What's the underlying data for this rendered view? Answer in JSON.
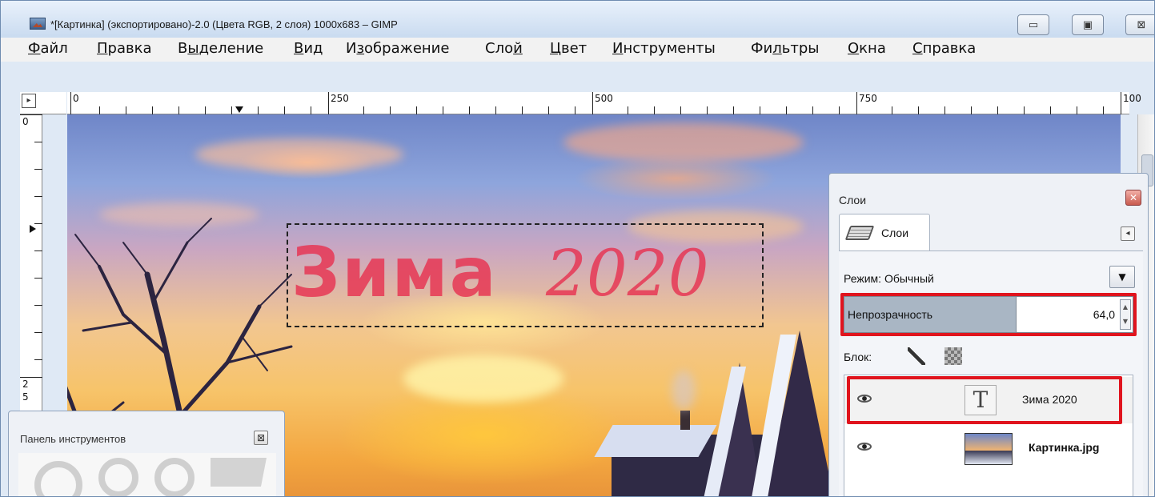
{
  "window": {
    "title": "*[Картинка] (экспортировано)-2.0 (Цвета RGB, 2 слоя) 1000x683 – GIMP",
    "minimize_glyph": "▭",
    "maximize_glyph": "▣",
    "close_glyph": "⊠"
  },
  "menu": [
    {
      "pre": "",
      "u": "Ф",
      "post": "айл"
    },
    {
      "pre": "",
      "u": "П",
      "post": "равка"
    },
    {
      "pre": "В",
      "u": "ы",
      "post": "деление"
    },
    {
      "pre": "",
      "u": "В",
      "post": "ид"
    },
    {
      "pre": "И",
      "u": "з",
      "post": "ображение"
    },
    {
      "pre": "Сло",
      "u": "й",
      "post": ""
    },
    {
      "pre": "",
      "u": "Ц",
      "post": "вет"
    },
    {
      "pre": "",
      "u": "И",
      "post": "нструменты"
    },
    {
      "pre": "Фи",
      "u": "л",
      "post": "ьтры"
    },
    {
      "pre": "",
      "u": "О",
      "post": "кна"
    },
    {
      "pre": "",
      "u": "С",
      "post": "правка"
    }
  ],
  "ruler": {
    "h_labels": [
      "0",
      "250",
      "500",
      "750",
      "100"
    ],
    "v_labels": [
      "0",
      "2",
      "5"
    ],
    "corner_glyph": "▸"
  },
  "canvas_text": {
    "word": "Зима",
    "year": "2020"
  },
  "toolbox": {
    "title": "Панель инструментов",
    "close_glyph": "⊠"
  },
  "layers_panel": {
    "title": "Слои",
    "close_glyph": "✕",
    "tab_label": "Слои",
    "tab_menu_glyph": "◂",
    "mode_label": "Режим: Обычный",
    "mode_arrow": "▼",
    "opacity_label": "Непрозрачность",
    "opacity_value": "64,0",
    "opacity_fraction": 0.64,
    "spin_up": "▲",
    "spin_down": "▼",
    "lock_label": "Блок:",
    "layers": [
      {
        "name": "Зима 2020",
        "type": "text",
        "thumb_glyph": "T",
        "visible": true,
        "selected": true
      },
      {
        "name": "Картинка.jpg",
        "type": "image",
        "visible": true,
        "selected": false
      }
    ]
  },
  "colors": {
    "highlight_red": "#e0141e",
    "text_layer_color": "#e63250"
  }
}
